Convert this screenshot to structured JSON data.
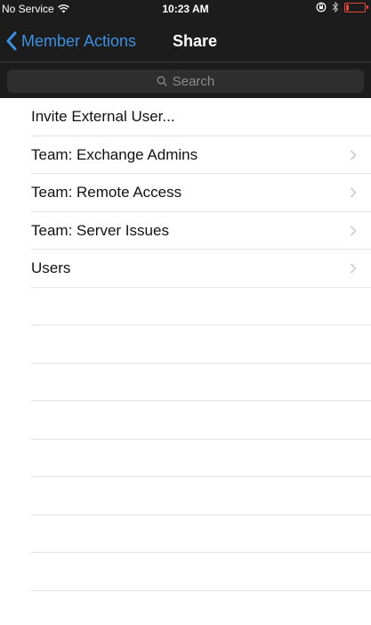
{
  "status_bar": {
    "carrier": "No Service",
    "time": "10:23 AM",
    "battery_percent": 15,
    "icons": [
      "wifi-icon",
      "lock-rotation-icon",
      "bluetooth-icon",
      "battery-icon"
    ]
  },
  "nav": {
    "back_label": "Member Actions",
    "title": "Share"
  },
  "search": {
    "placeholder": "Search"
  },
  "list": {
    "items": [
      {
        "label": "Invite External User...",
        "has_chevron": false
      },
      {
        "label": "Team: Exchange Admins",
        "has_chevron": true
      },
      {
        "label": "Team: Remote Access",
        "has_chevron": true
      },
      {
        "label": "Team: Server Issues",
        "has_chevron": true
      },
      {
        "label": "Users",
        "has_chevron": true
      }
    ]
  },
  "colors": {
    "nav_background": "#1c1c1c",
    "accent": "#3d8fe0",
    "battery_low": "#e5473d",
    "separator": "#e3e3e6"
  }
}
